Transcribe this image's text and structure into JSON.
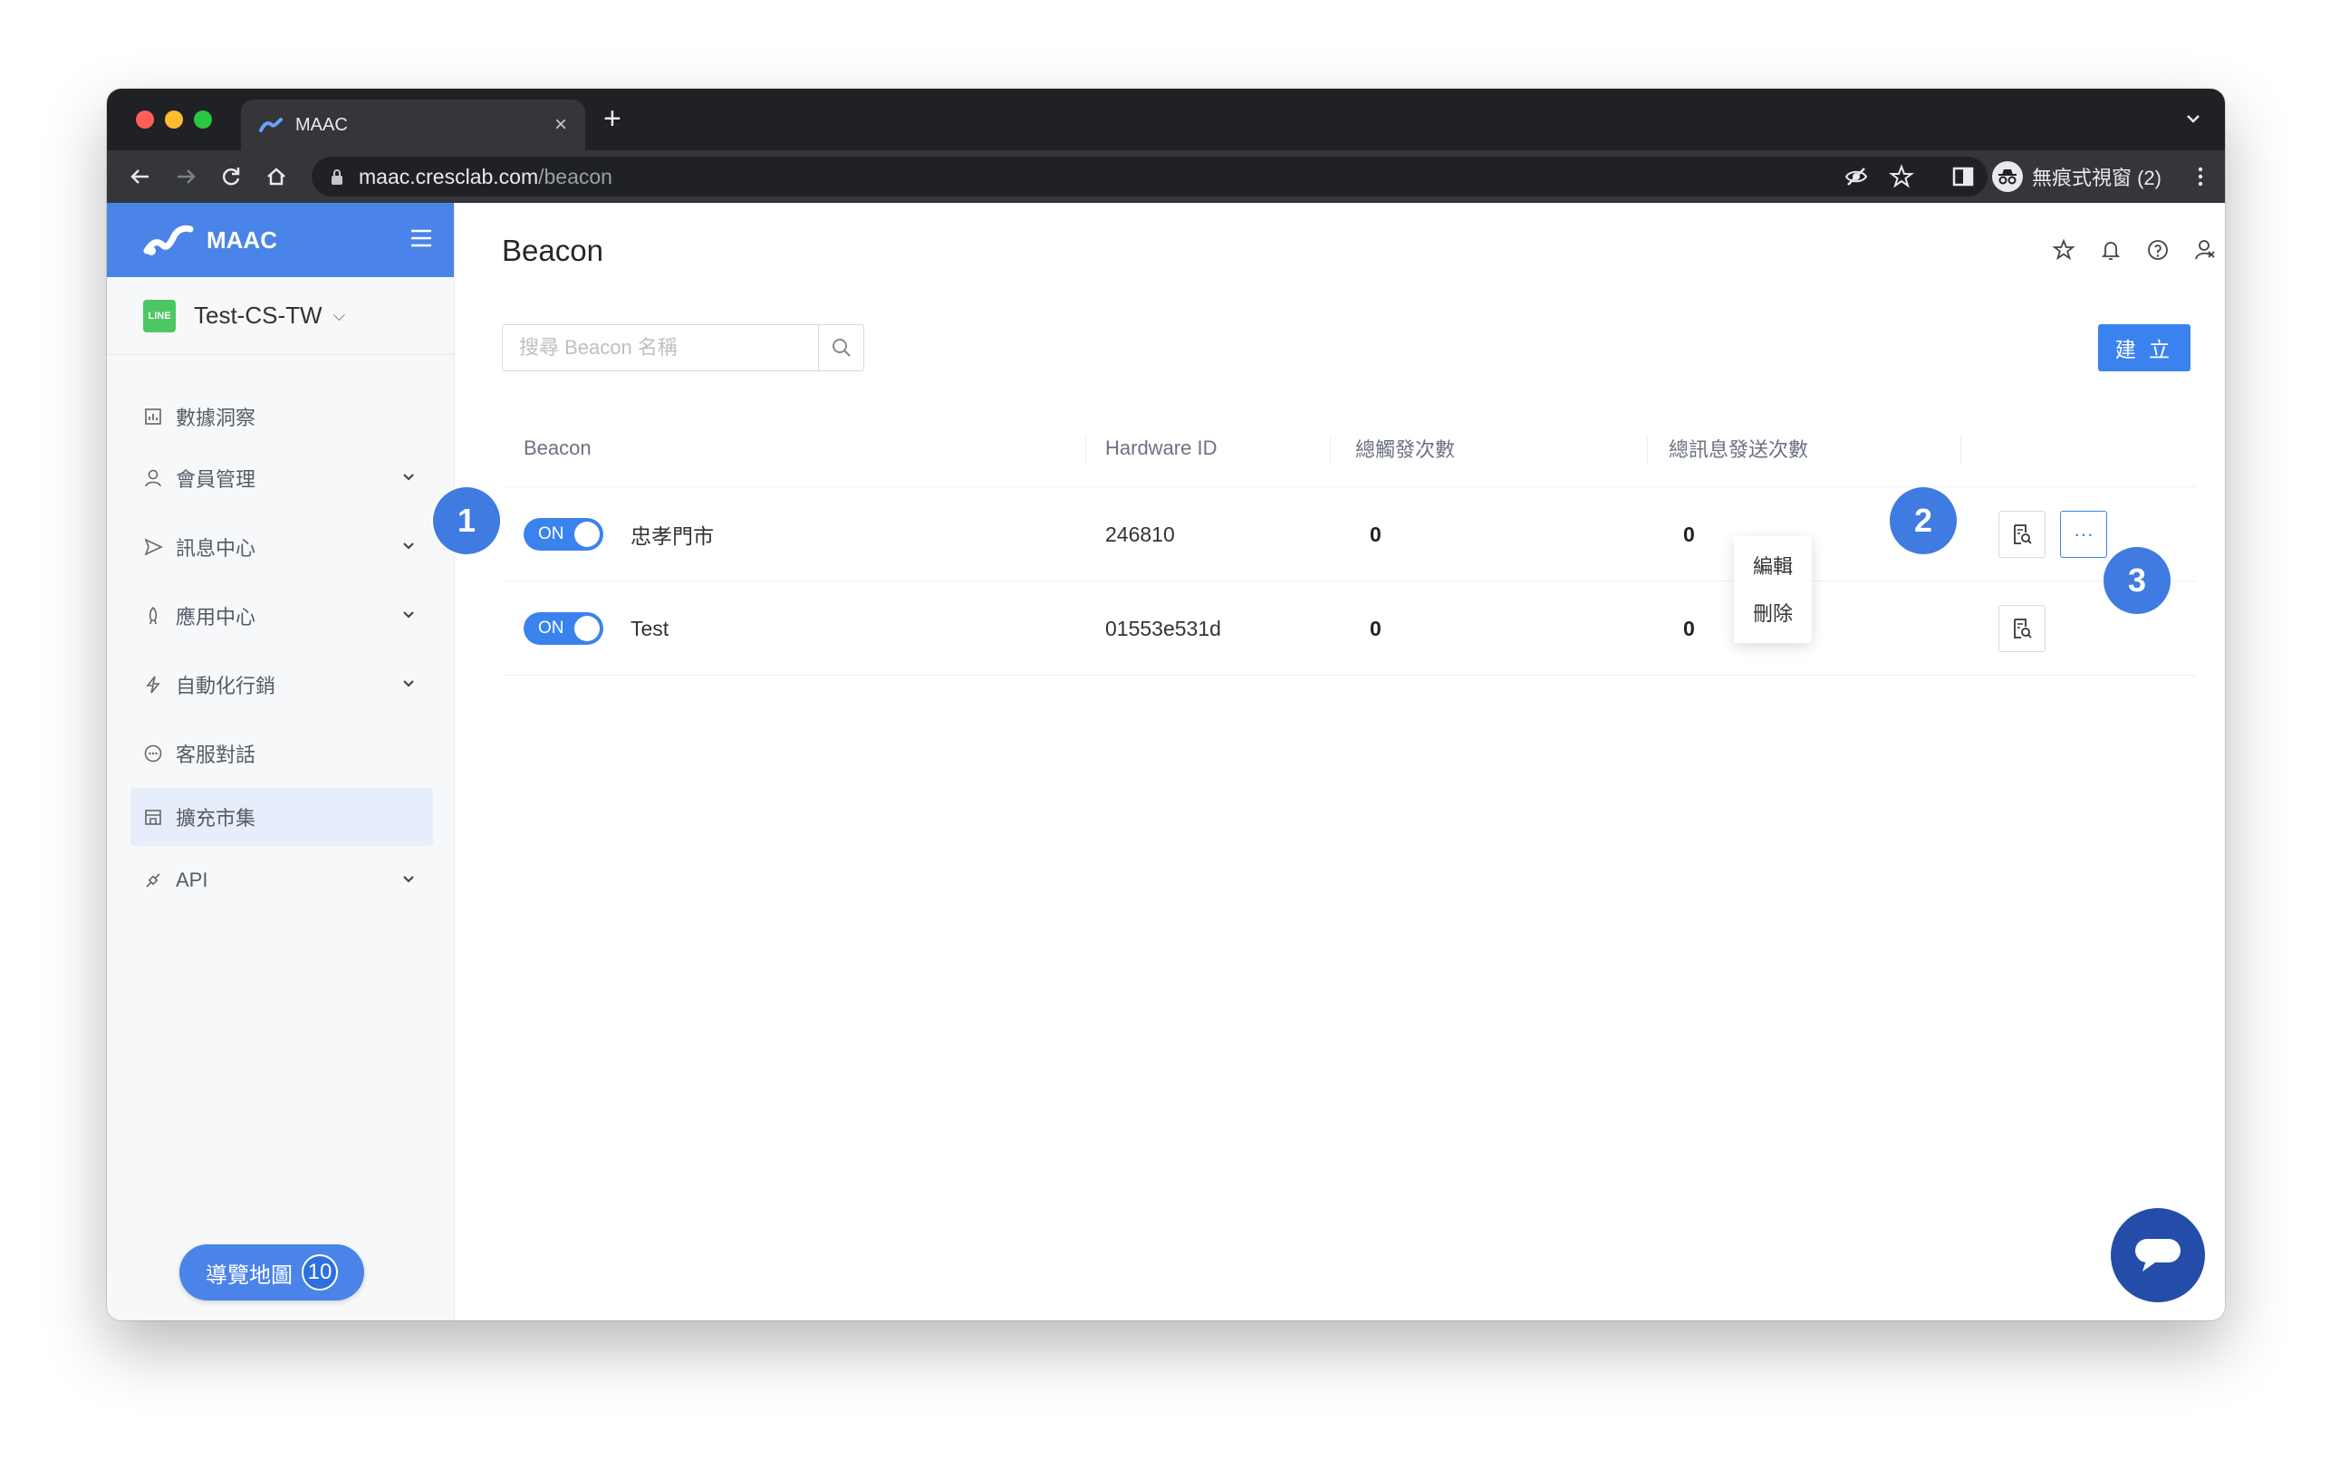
{
  "browser": {
    "tab_title": "MAAC",
    "url_host": "maac.cresclab.com",
    "url_path": "/beacon",
    "profile_label": "無痕式視窗 (2)"
  },
  "sidebar": {
    "brand": "MAAC",
    "account": {
      "name": "Test-CS-TW",
      "badge": "LINE"
    },
    "items": [
      {
        "label": "數據洞察",
        "icon": "bar-chart-icon",
        "expandable": false
      },
      {
        "label": "會員管理",
        "icon": "user-icon",
        "expandable": true
      },
      {
        "label": "訊息中心",
        "icon": "send-icon",
        "expandable": true
      },
      {
        "label": "應用中心",
        "icon": "rocket-icon",
        "expandable": true
      },
      {
        "label": "自動化行銷",
        "icon": "lightning-icon",
        "expandable": true
      },
      {
        "label": "客服對話",
        "icon": "chat-bubble-icon",
        "expandable": false
      },
      {
        "label": "擴充市集",
        "icon": "store-icon",
        "expandable": false,
        "active": true
      },
      {
        "label": "API",
        "icon": "api-icon",
        "expandable": true
      }
    ],
    "guide": {
      "label": "導覽地圖",
      "count": "10"
    }
  },
  "main": {
    "title": "Beacon",
    "search_placeholder": "搜尋 Beacon 名稱",
    "create_label": "建 立",
    "columns": [
      "Beacon",
      "Hardware ID",
      "總觸發次數",
      "總訊息發送次數"
    ],
    "rows": [
      {
        "toggle": "ON",
        "name": "忠孝門市",
        "hardware_id": "246810",
        "triggers": "0",
        "messages": "0"
      },
      {
        "toggle": "ON",
        "name": "Test",
        "hardware_id": "01553e531d",
        "triggers": "0",
        "messages": "0"
      }
    ],
    "more_menu": [
      "編輯",
      "刪除"
    ],
    "more_button_label": "···"
  },
  "markers": [
    "1",
    "2",
    "3"
  ],
  "colors": {
    "brand_blue": "#4a84e8",
    "primary": "#3a83ee",
    "marker": "#3f7be0",
    "chat_fab": "#234da8",
    "line_green": "#4cc764"
  }
}
